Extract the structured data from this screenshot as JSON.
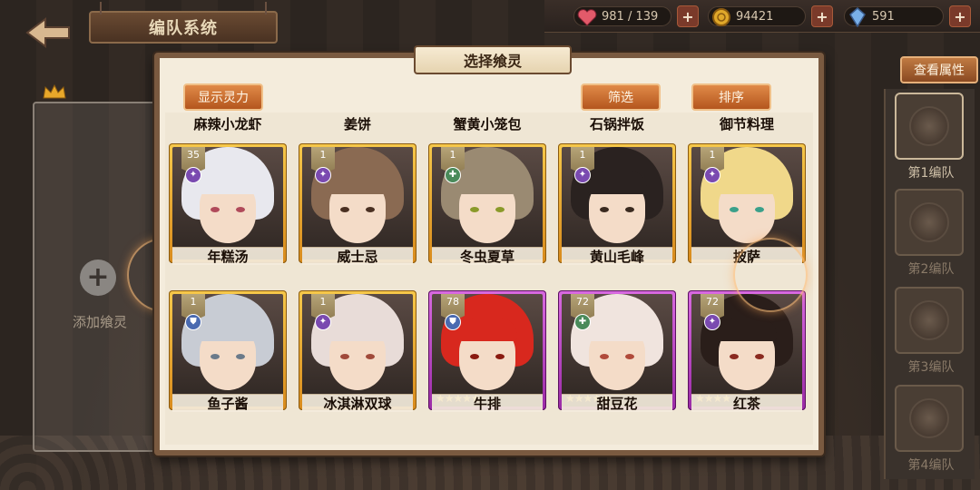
{
  "header": {
    "back_icon": "back-arrow-icon",
    "title": "编队系统"
  },
  "resources": {
    "stamina": {
      "icon": "heart-icon",
      "value": "981 / 139",
      "color": "#e25a6a"
    },
    "gold": {
      "icon": "coin-icon",
      "value": "94421",
      "color": "#e0a82a"
    },
    "gems": {
      "icon": "crystal-icon",
      "value": "591",
      "color": "#7ab0e8"
    }
  },
  "view_attributes_label": "查看属性",
  "slot_panel": {
    "add_label": "添加飨灵"
  },
  "teams": [
    {
      "label": "第1编队"
    },
    {
      "label": "第2编队"
    },
    {
      "label": "第3编队"
    },
    {
      "label": "第4编队"
    }
  ],
  "dialog": {
    "title": "选择飨灵",
    "show_power_label": "显示灵力",
    "filter_label": "筛选",
    "sort_label": "排序"
  },
  "previous_row_names": [
    "麻辣小龙虾",
    "姜饼",
    "蟹黄小笼包",
    "石锅拌饭",
    "御节料理"
  ],
  "cards": [
    {
      "name": "年糕汤",
      "level": "35",
      "rarity": "gold",
      "element": "star",
      "hair": "#e8e8ee",
      "eye": "#b04a5a"
    },
    {
      "name": "威士忌",
      "level": "1",
      "rarity": "gold",
      "element": "star",
      "hair": "#8a6a52",
      "eye": "#4a3022"
    },
    {
      "name": "冬虫夏草",
      "level": "1",
      "rarity": "gold",
      "element": "leaf",
      "hair": "#9a8a72",
      "eye": "#8a9a2a"
    },
    {
      "name": "黄山毛峰",
      "level": "1",
      "rarity": "gold",
      "element": "star",
      "hair": "#2a2220",
      "eye": "#3a2a20"
    },
    {
      "name": "披萨",
      "level": "1",
      "rarity": "gold",
      "element": "star",
      "hair": "#f0d88a",
      "eye": "#3aa08a"
    },
    {
      "name": "鱼子酱",
      "level": "1",
      "rarity": "gold",
      "element": "shield",
      "hair": "#c8ccd4",
      "eye": "#6a7a8a",
      "stars": ""
    },
    {
      "name": "冰淇淋双球",
      "level": "1",
      "rarity": "gold",
      "element": "star",
      "hair": "#e8dcd8",
      "eye": "#a04a3a",
      "stars": ""
    },
    {
      "name": "牛排",
      "level": "78",
      "rarity": "purple",
      "element": "shield",
      "hair": "#d8281e",
      "eye": "#8a1a10",
      "stars": "★★★★★"
    },
    {
      "name": "甜豆花",
      "level": "72",
      "rarity": "purple",
      "element": "leaf",
      "hair": "#f0e4de",
      "eye": "#b04a3a",
      "stars": "★★★★★"
    },
    {
      "name": "红茶",
      "level": "72",
      "rarity": "purple",
      "element": "star",
      "hair": "#2a1e1a",
      "eye": "#8a2a20",
      "stars": "★★★★"
    }
  ]
}
